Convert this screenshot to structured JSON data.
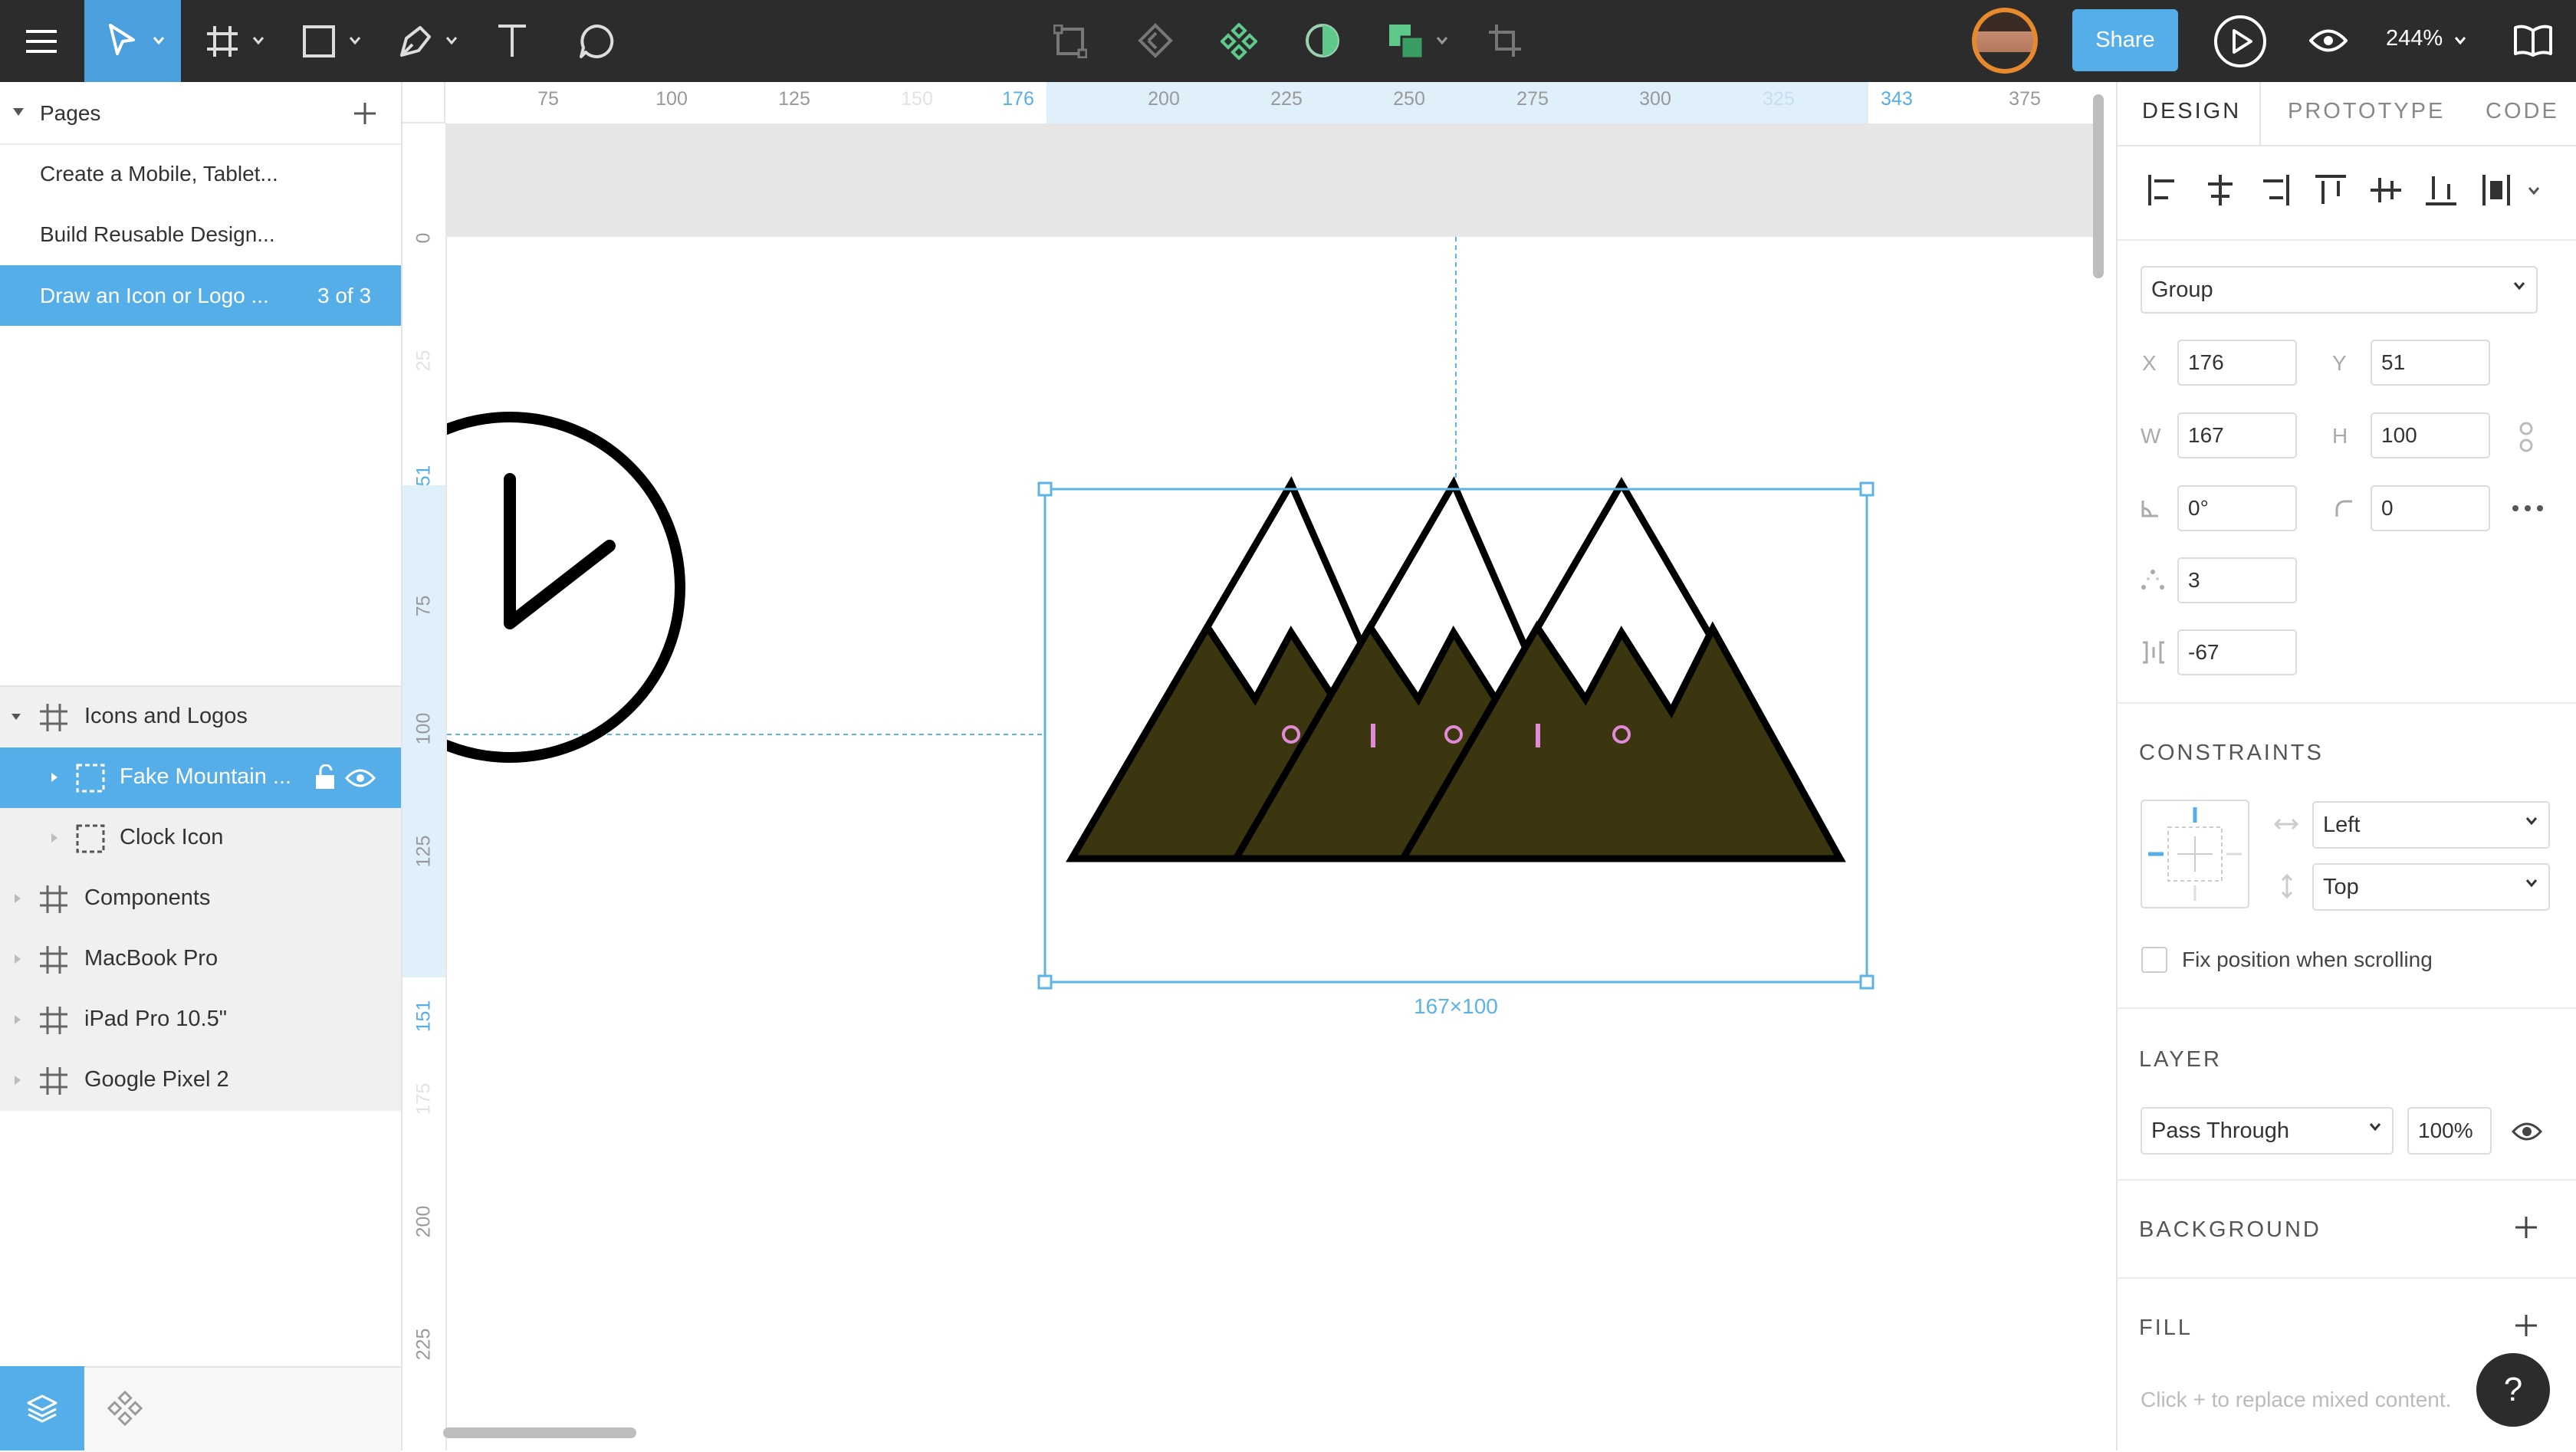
{
  "toolbar": {
    "share_label": "Share",
    "zoom_label": "244%",
    "icons": [
      "menu-icon",
      "pointer-icon",
      "frame-icon",
      "rectangle-icon",
      "pen-icon",
      "text-icon",
      "comment-icon",
      "resize-icon",
      "component-link-icon",
      "component-icon",
      "mask-icon",
      "boolean-icon",
      "crop-icon",
      "play-icon",
      "eye-icon",
      "book-icon"
    ]
  },
  "pages": {
    "header": "Pages",
    "items": [
      {
        "label": "Create a Mobile, Tablet..."
      },
      {
        "label": "Build Reusable Design..."
      },
      {
        "label": "Draw an Icon or Logo ...",
        "count": "3 of 3"
      }
    ]
  },
  "layers": {
    "items": [
      {
        "label": "Icons and Logos"
      },
      {
        "label": "Fake Mountain ..."
      },
      {
        "label": "Clock Icon"
      },
      {
        "label": "Components"
      },
      {
        "label": "MacBook Pro"
      },
      {
        "label": "iPad Pro 10.5\""
      },
      {
        "label": "Google Pixel 2"
      }
    ]
  },
  "ruler": {
    "h_ticks": [
      "75",
      "100",
      "125",
      "150",
      "176",
      "200",
      "225",
      "250",
      "275",
      "300",
      "325",
      "343",
      "375"
    ],
    "v_ticks": [
      "0",
      "25",
      "51",
      "75",
      "100",
      "125",
      "151",
      "175",
      "200",
      "225"
    ]
  },
  "canvas": {
    "selection_size_label": "167×100",
    "mountain_fill": "#3b3510",
    "selection_color": "#5bb3e6"
  },
  "inspector": {
    "tabs": [
      "DESIGN",
      "PROTOTYPE",
      "CODE"
    ],
    "group_select": "Group",
    "x_label": "X",
    "x_value": "176",
    "y_label": "Y",
    "y_value": "51",
    "w_label": "W",
    "w_value": "167",
    "h_label": "H",
    "h_value": "100",
    "rotation_value": "0°",
    "radius_value": "0",
    "points_value": "3",
    "spacing_value": "-67",
    "constraints_title": "CONSTRAINTS",
    "constraint_h": "Left",
    "constraint_v": "Top",
    "fix_position_label": "Fix position when scrolling",
    "layer_title": "LAYER",
    "blend_mode": "Pass Through",
    "opacity": "100%",
    "background_title": "BACKGROUND",
    "fill_title": "FILL",
    "fill_hint": "Click + to replace mixed content.",
    "help_label": "?"
  },
  "colors": {
    "accent": "#55aee8",
    "topbar": "#2c2c2c"
  }
}
